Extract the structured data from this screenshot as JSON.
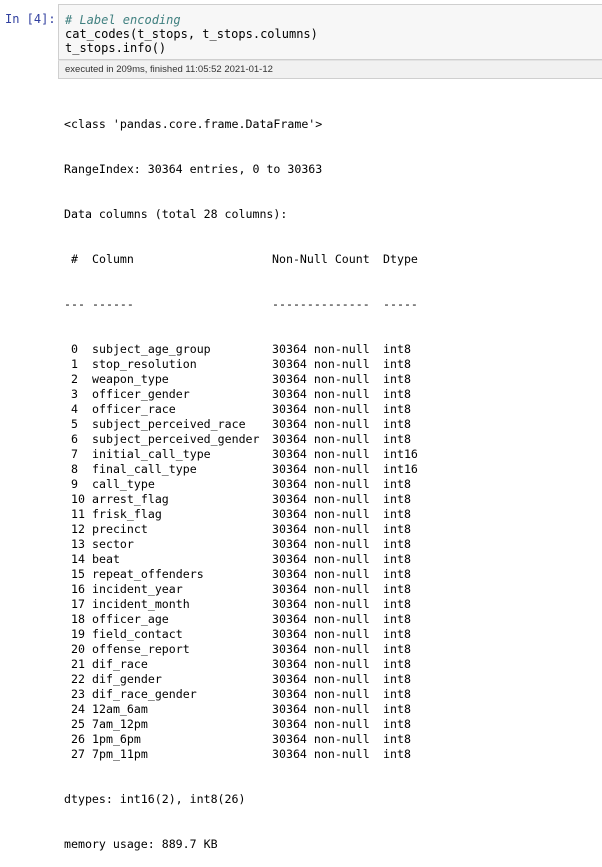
{
  "cell": {
    "prompt": "In [4]:",
    "code_comment": "# Label encoding",
    "code_line2": "cat_codes(t_stops, t_stops.columns)",
    "code_line3": "t_stops.info()",
    "exec_info": "executed in 209ms, finished 11:05:52 2021-01-12"
  },
  "output": {
    "class_line": "<class 'pandas.core.frame.DataFrame'>",
    "range_index": "RangeIndex: 30364 entries, 0 to 30363",
    "data_columns": "Data columns (total 28 columns):",
    "header": {
      "idx": " #",
      "column": "Column",
      "count": "Non-Null Count",
      "dtype": "Dtype"
    },
    "separator": {
      "idx": "---",
      "column": "------",
      "count": "--------------",
      "dtype": "-----"
    },
    "rows": [
      {
        "idx": " 0",
        "column": "subject_age_group",
        "count": "30364 non-null",
        "dtype": "int8"
      },
      {
        "idx": " 1",
        "column": "stop_resolution",
        "count": "30364 non-null",
        "dtype": "int8"
      },
      {
        "idx": " 2",
        "column": "weapon_type",
        "count": "30364 non-null",
        "dtype": "int8"
      },
      {
        "idx": " 3",
        "column": "officer_gender",
        "count": "30364 non-null",
        "dtype": "int8"
      },
      {
        "idx": " 4",
        "column": "officer_race",
        "count": "30364 non-null",
        "dtype": "int8"
      },
      {
        "idx": " 5",
        "column": "subject_perceived_race",
        "count": "30364 non-null",
        "dtype": "int8"
      },
      {
        "idx": " 6",
        "column": "subject_perceived_gender",
        "count": "30364 non-null",
        "dtype": "int8"
      },
      {
        "idx": " 7",
        "column": "initial_call_type",
        "count": "30364 non-null",
        "dtype": "int16"
      },
      {
        "idx": " 8",
        "column": "final_call_type",
        "count": "30364 non-null",
        "dtype": "int16"
      },
      {
        "idx": " 9",
        "column": "call_type",
        "count": "30364 non-null",
        "dtype": "int8"
      },
      {
        "idx": " 10",
        "column": "arrest_flag",
        "count": "30364 non-null",
        "dtype": "int8"
      },
      {
        "idx": " 11",
        "column": "frisk_flag",
        "count": "30364 non-null",
        "dtype": "int8"
      },
      {
        "idx": " 12",
        "column": "precinct",
        "count": "30364 non-null",
        "dtype": "int8"
      },
      {
        "idx": " 13",
        "column": "sector",
        "count": "30364 non-null",
        "dtype": "int8"
      },
      {
        "idx": " 14",
        "column": "beat",
        "count": "30364 non-null",
        "dtype": "int8"
      },
      {
        "idx": " 15",
        "column": "repeat_offenders",
        "count": "30364 non-null",
        "dtype": "int8"
      },
      {
        "idx": " 16",
        "column": "incident_year",
        "count": "30364 non-null",
        "dtype": "int8"
      },
      {
        "idx": " 17",
        "column": "incident_month",
        "count": "30364 non-null",
        "dtype": "int8"
      },
      {
        "idx": " 18",
        "column": "officer_age",
        "count": "30364 non-null",
        "dtype": "int8"
      },
      {
        "idx": " 19",
        "column": "field_contact",
        "count": "30364 non-null",
        "dtype": "int8"
      },
      {
        "idx": " 20",
        "column": "offense_report",
        "count": "30364 non-null",
        "dtype": "int8"
      },
      {
        "idx": " 21",
        "column": "dif_race",
        "count": "30364 non-null",
        "dtype": "int8"
      },
      {
        "idx": " 22",
        "column": "dif_gender",
        "count": "30364 non-null",
        "dtype": "int8"
      },
      {
        "idx": " 23",
        "column": "dif_race_gender",
        "count": "30364 non-null",
        "dtype": "int8"
      },
      {
        "idx": " 24",
        "column": "12am_6am",
        "count": "30364 non-null",
        "dtype": "int8"
      },
      {
        "idx": " 25",
        "column": "7am_12pm",
        "count": "30364 non-null",
        "dtype": "int8"
      },
      {
        "idx": " 26",
        "column": "1pm_6pm",
        "count": "30364 non-null",
        "dtype": "int8"
      },
      {
        "idx": " 27",
        "column": "7pm_11pm",
        "count": "30364 non-null",
        "dtype": "int8"
      }
    ],
    "dtypes": "dtypes: int16(2), int8(26)",
    "memory": "memory usage: 889.7 KB"
  }
}
